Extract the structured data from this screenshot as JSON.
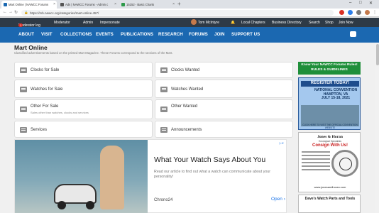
{
  "browser": {
    "tabs": [
      {
        "label": "Mart Online | NAWCC Forums",
        "active": true,
        "favicon_color": "#1b68b1"
      },
      {
        "label": "Ads | NAWCC Forums - Admin c",
        "active": false,
        "favicon_color": "#555555"
      },
      {
        "label": "15152 - Basic Charts",
        "active": false,
        "favicon_color": "#2e9a4a"
      }
    ],
    "new_tab": "+",
    "window_controls": [
      "–",
      "□",
      "✕"
    ],
    "url": "https://mb.nawcc.org/categories/mart-online.457/"
  },
  "admin_bar": {
    "moderator_log": "Moderator log",
    "moderator_log_count": "1",
    "moderator": "Moderator",
    "admin": "Admin",
    "impersonate": "Impersonate",
    "user": "Tom McIntyre",
    "local_chapters": "Local Chapters",
    "business_directory": "Business Directory",
    "search": "Search",
    "shop": "Shop",
    "join_now": "Join Now"
  },
  "main_nav": [
    "ABOUT",
    "VISIT",
    "COLLECTIONS",
    "EVENTS",
    "PUBLICATIONS",
    "RESEARCH",
    "FORUMS",
    "JOIN",
    "SUPPORT US"
  ],
  "page": {
    "title": "Mart Online",
    "description": "Classified advertisements based on the printed Mart Magazine. These Forums correspond to the sections of the Mart."
  },
  "forums": [
    {
      "title": "Clocks for Sale",
      "sub": ""
    },
    {
      "title": "Clocks Wanted",
      "sub": ""
    },
    {
      "title": "Watches for Sale",
      "sub": ""
    },
    {
      "title": "Watches Wanted",
      "sub": ""
    },
    {
      "title": "Other For Sale",
      "sub": "Sales other than watches, clocks and services"
    },
    {
      "title": "Other Wanted",
      "sub": ""
    },
    {
      "title": "Services",
      "sub": ""
    },
    {
      "title": "Announcements",
      "sub": ""
    }
  ],
  "ad": {
    "title": "What Your Watch Says About You",
    "text": "Read our article to find out what a watch can communicate about your personality!",
    "brand": "Chrono24",
    "open_label": "Open",
    "open_chevron": "›",
    "adchoices": "▷✕"
  },
  "sidebar": {
    "rules_line1": "Know Your NAWCC Forums Rules!",
    "rules_line2": "RULES & GUIDELINES",
    "convention_register": "REGISTER TODAY!",
    "convention_name": "NATIONAL CONVENTION",
    "convention_place": "HAMPTON, VA",
    "convention_dates": "JULY 15-18, 2021",
    "convention_cta": "CLICK HERE TO VISIT THE OFFICIAL CONVENTION WEBSITE",
    "jh_name": "Jones & Horan",
    "jh_sub": "Horological Specialists",
    "jh_consign": "Consign With Us!",
    "jh_web": "www.jonesandhoran.com",
    "dave_title": "Dave's Watch Parts and Tools"
  },
  "colors": {
    "admin_bar": "#2e3a46",
    "nav": "#1b68b1",
    "rules_green": "#1f8f3a"
  }
}
